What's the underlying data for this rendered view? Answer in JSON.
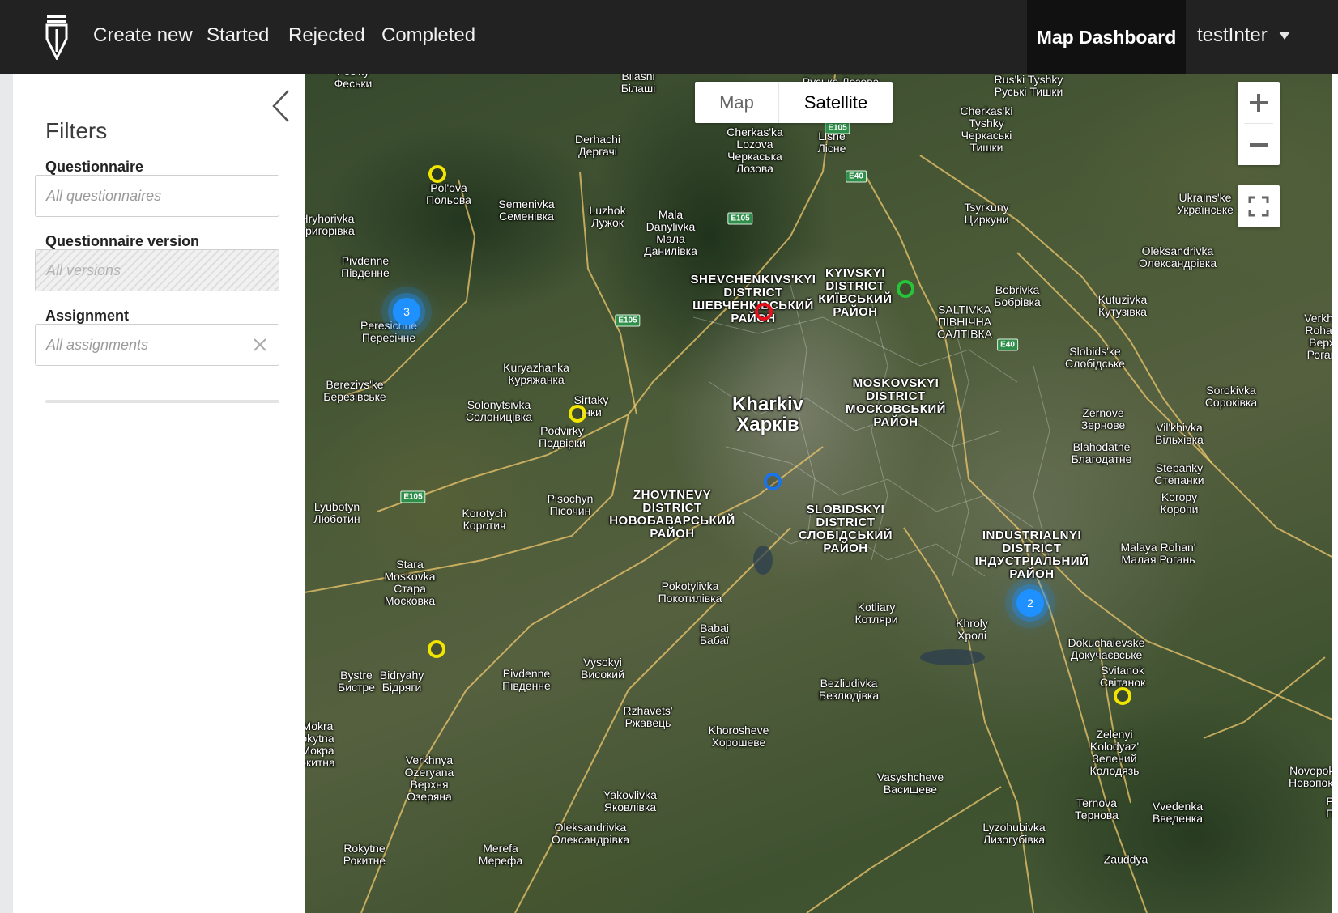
{
  "nav": {
    "links": [
      "Create new",
      "Started",
      "Rejected",
      "Completed"
    ],
    "active": "Map Dashboard",
    "user": "testInter"
  },
  "filters": {
    "title": "Filters",
    "questionnaire": {
      "label": "Questionnaire",
      "placeholder": "All questionnaires"
    },
    "version": {
      "label": "Questionnaire version",
      "placeholder": "All versions"
    },
    "assignment": {
      "label": "Assignment",
      "placeholder": "All assignments"
    }
  },
  "map": {
    "type_options": [
      "Map",
      "Satellite"
    ],
    "selected_type": "Satellite",
    "icons": [
      "zoom-in-icon",
      "zoom-out-icon",
      "fullscreen-icon"
    ],
    "places": [
      {
        "text": "Fes'ky\nФеськи",
        "kind": "town"
      },
      {
        "text": "Bilashi\nБілаші",
        "kind": "town"
      },
      {
        "text": "Rus'ka Lozova\nРуська Лозова",
        "kind": "town"
      },
      {
        "text": "Rus'ki Tyshky\nРуські Тишки",
        "kind": "town"
      },
      {
        "text": "Derhachi\nДергачі",
        "kind": "town"
      },
      {
        "text": "Cherkas'ka\nLozova\nЧеркаська\nЛозова",
        "kind": "town"
      },
      {
        "text": "Lisne\nЛісне",
        "kind": "town"
      },
      {
        "text": "Cherkas'ki\nTyshky\nЧеркаські\nТишки",
        "kind": "town"
      },
      {
        "text": "Pol'ova\nПольова",
        "kind": "town"
      },
      {
        "text": "Semenivka\nСеменівка",
        "kind": "town"
      },
      {
        "text": "Luzhok\nЛужок",
        "kind": "town"
      },
      {
        "text": "Mala\nDanylivka\nМала\nДанилівка",
        "kind": "town"
      },
      {
        "text": "Hryhorivka\nГригорівка",
        "kind": "town"
      },
      {
        "text": "Tsyrkuny\nЦиркуни",
        "kind": "town"
      },
      {
        "text": "Ukrains'ke\nУкраїнське",
        "kind": "town"
      },
      {
        "text": "Pivdenne\nПівденне",
        "kind": "town"
      },
      {
        "text": "Oleksandrivka\nОлександрівка",
        "kind": "town"
      },
      {
        "text": "SHEVCHENKIVS'KYI\nDISTRICT\nШЕВЧЕНКІВСЬКИЙ\nРАЙОН",
        "kind": "district"
      },
      {
        "text": "KYIVSKYI\nDISTRICT\nКИЇВСЬКИЙ\nРАЙОН",
        "kind": "district"
      },
      {
        "text": "Bobrivka\nБобрівка",
        "kind": "town"
      },
      {
        "text": "Kutuzivka\nКутузівка",
        "kind": "town"
      },
      {
        "text": "SALTIVKA\nПІВНІЧНА\nСАЛТІВКА",
        "kind": "town"
      },
      {
        "text": "Peresichne\nПересічне",
        "kind": "town"
      },
      {
        "text": "Verkhn\nRohan\nВерх\nРоган",
        "kind": "town"
      },
      {
        "text": "Slobids'ke\nСлобідське",
        "kind": "town"
      },
      {
        "text": "Kuryazhanka\nКуряжанка",
        "kind": "town"
      },
      {
        "text": "MOSKOVSKYI\nDISTRICT\nМОСКОВСЬКИЙ\nРАЙОН",
        "kind": "district"
      },
      {
        "text": "Berezivs'ke\nБерезівське",
        "kind": "town"
      },
      {
        "text": "Sorokivka\nСороківка",
        "kind": "town"
      },
      {
        "text": "Kharkiv\nХарків",
        "kind": "city"
      },
      {
        "text": "Solonytsivka\nСолоницівка",
        "kind": "town"
      },
      {
        "text": "Sirtaky\nІнки",
        "kind": "town"
      },
      {
        "text": "Zernove\nЗернове",
        "kind": "town"
      },
      {
        "text": "Podvirky\nПодвірки",
        "kind": "town"
      },
      {
        "text": "Vil'khivka\nВільхівка",
        "kind": "town"
      },
      {
        "text": "Blahodatne\nБлагодатне",
        "kind": "town"
      },
      {
        "text": "Stepanky\nСтепанки",
        "kind": "town"
      },
      {
        "text": "Lyubotyn\nЛюботин",
        "kind": "town"
      },
      {
        "text": "Pisochyn\nПісочин",
        "kind": "town"
      },
      {
        "text": "Korotych\nКоротич",
        "kind": "town"
      },
      {
        "text": "ZHOVTNEVY\nDISTRICT\nНОВОБАВАРСЬКИЙ\nРАЙОН",
        "kind": "district"
      },
      {
        "text": "SLOBIDSKYI\nDISTRICT\nСЛОБІДСЬКИЙ\nРАЙОН",
        "kind": "district"
      },
      {
        "text": "Koropy\nКоропи",
        "kind": "town"
      },
      {
        "text": "INDUSTRIALNYI\nDISTRICT\nІНДУСТРІАЛЬНИЙ\nРАЙОН",
        "kind": "district"
      },
      {
        "text": "Malaya Rohan'\nМалая Рогань",
        "kind": "town"
      },
      {
        "text": "Stara\nMoskovka\nСтара\nМосковка",
        "kind": "town"
      },
      {
        "text": "Pokotylivka\nПокотилівка",
        "kind": "town"
      },
      {
        "text": "Kotliary\nКотляри",
        "kind": "town"
      },
      {
        "text": "Khroly\nХролі",
        "kind": "town"
      },
      {
        "text": "Babai\nБабаї",
        "kind": "town"
      },
      {
        "text": "Dokuchaievske\nДокучаєвське",
        "kind": "town"
      },
      {
        "text": "Svitanok\nСвітанок",
        "kind": "town"
      },
      {
        "text": "Bystre\nБистре",
        "kind": "town"
      },
      {
        "text": "Bidryahy\nБідряги",
        "kind": "town"
      },
      {
        "text": "Pivdenne\nПівденне",
        "kind": "town"
      },
      {
        "text": "Vysokyi\nВисокий",
        "kind": "town"
      },
      {
        "text": "Bezliudivka\nБезлюдівка",
        "kind": "town"
      },
      {
        "text": "Rzhavets'\nРжавець",
        "kind": "town"
      },
      {
        "text": "Khoroshevе\nХорошеве",
        "kind": "town"
      },
      {
        "text": "Zelenyi\nKolodyaz'\nЗелений\nКолодязь",
        "kind": "town"
      },
      {
        "text": "Mokra\nokytna\nМокра\nокитна",
        "kind": "town"
      },
      {
        "text": "Verkhnya\nOzeryana\nВерхня\nОзеряна",
        "kind": "town"
      },
      {
        "text": "Vasyshcheve\nВасищеве",
        "kind": "town"
      },
      {
        "text": "Novopokro\nНовопокро",
        "kind": "town"
      },
      {
        "text": "Yakovlivka\nЯковлівка",
        "kind": "town"
      },
      {
        "text": "Ternova\nТернова",
        "kind": "town"
      },
      {
        "text": "Vvedenka\nВведенка",
        "kind": "town"
      },
      {
        "text": "Po\nПо",
        "kind": "town"
      },
      {
        "text": "Oleksandrivka\nОлександрівка",
        "kind": "town"
      },
      {
        "text": "Rokytne\nРокитне",
        "kind": "town"
      },
      {
        "text": "Merefa\nМерефа",
        "kind": "town"
      },
      {
        "text": "Lyzohubivka\nЛизогубівка",
        "kind": "town"
      },
      {
        "text": "Zauddya",
        "kind": "town"
      }
    ],
    "road_shields": [
      "E105",
      "E40",
      "E105",
      "E105",
      "E40",
      "E105"
    ],
    "markers": [
      {
        "status": "yellow",
        "color": "#f2e600"
      },
      {
        "status": "green",
        "color": "#27c43a"
      },
      {
        "status": "red",
        "color": "#e4101a"
      },
      {
        "status": "yellow",
        "color": "#f2e600"
      },
      {
        "status": "blue",
        "color": "#1a73e8"
      },
      {
        "status": "yellow",
        "color": "#f2e600"
      },
      {
        "status": "yellow",
        "color": "#f2e600"
      }
    ],
    "clusters": [
      {
        "count": "3"
      },
      {
        "count": "2"
      }
    ]
  }
}
